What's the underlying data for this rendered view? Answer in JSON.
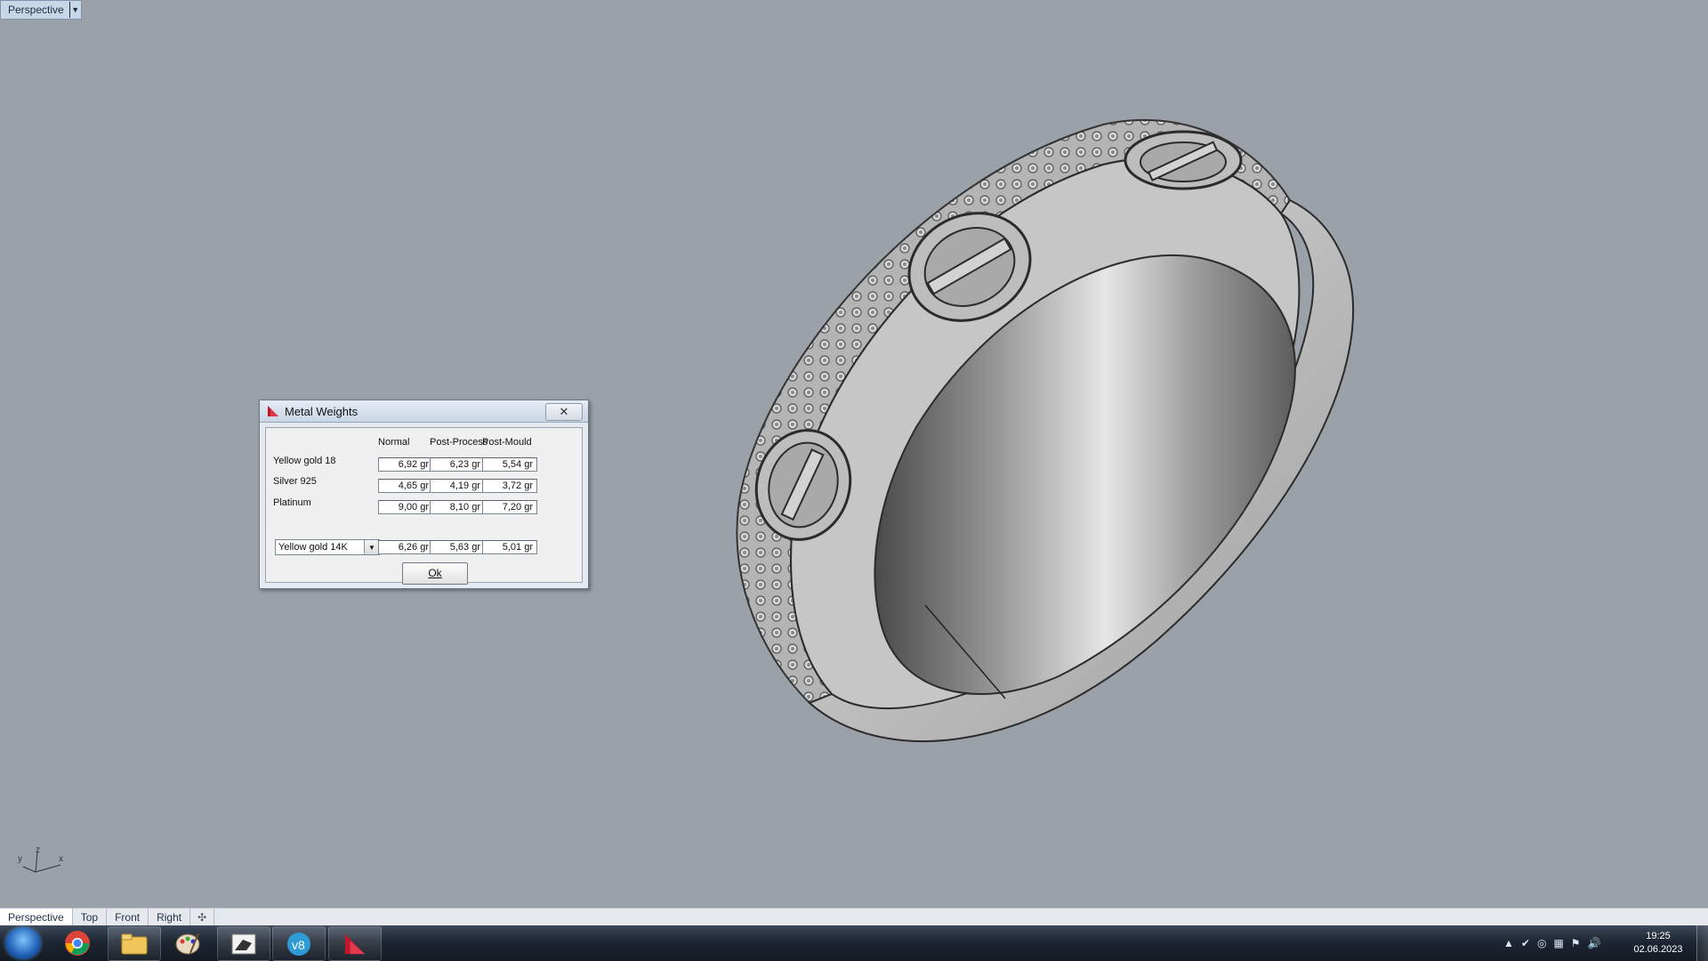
{
  "viewport": {
    "label": "Perspective",
    "axis": {
      "x": "x",
      "y": "y",
      "z": "z"
    }
  },
  "dialog": {
    "title": "Metal Weights",
    "close_symbol": "✕",
    "columns": [
      "Normal",
      "Post-Process",
      "Post-Mould"
    ],
    "rows": [
      {
        "label": "Yellow gold 18",
        "normal": "6,92 gr",
        "post_process": "6,23 gr",
        "post_mould": "5,54 gr"
      },
      {
        "label": "Silver 925",
        "normal": "4,65 gr",
        "post_process": "4,19 gr",
        "post_mould": "3,72 gr"
      },
      {
        "label": "Platinum",
        "normal": "9,00 gr",
        "post_process": "8,10 gr",
        "post_mould": "7,20 gr"
      }
    ],
    "custom_row": {
      "selected_metal": "Yellow gold 14K",
      "normal": "6,26 gr",
      "post_process": "5,63 gr",
      "post_mould": "5,01 gr"
    },
    "ok_label": "Ok"
  },
  "viewport_tabs": {
    "items": [
      "Perspective",
      "Top",
      "Front",
      "Right"
    ],
    "add_symbol": "✣"
  },
  "taskbar": {
    "apps": [
      "start-orb-icon",
      "chrome-icon",
      "file-explorer-icon",
      "paint-icon",
      "rhino-icon",
      "v8-icon",
      "matrix-icon"
    ],
    "clock_time": "19:25",
    "clock_date": "02.06.2023"
  }
}
